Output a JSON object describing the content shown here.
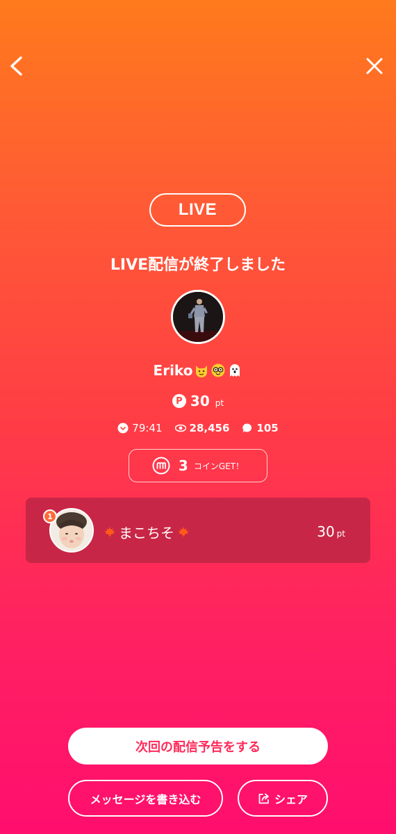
{
  "header": {
    "back_icon": "chevron-left-icon",
    "close_icon": "close-icon"
  },
  "live_badge": "LIVE",
  "end_title": "LIVE配信が終了しました",
  "broadcaster": {
    "name": "Eriko",
    "emojis": [
      "cat-face-icon",
      "nerd-face-icon",
      "ghost-icon"
    ]
  },
  "points": {
    "value": "30",
    "unit": "pt"
  },
  "stats": {
    "duration": "79:41",
    "viewers": "28,456",
    "comments": "105"
  },
  "coins": {
    "count": "3",
    "label": "コインGET！"
  },
  "ranking": [
    {
      "rank": "1",
      "name": "まこちそ",
      "points": "30",
      "unit": "pt"
    }
  ],
  "buttons": {
    "schedule": "次回の配信予告をする",
    "message": "メッセージを書き込む",
    "share": "シェア"
  },
  "colors": {
    "gradient_top": "#ff7a1c",
    "gradient_bottom": "#ff0e6e",
    "card_bg": "#c82646",
    "accent_text": "#ff2a5a"
  }
}
